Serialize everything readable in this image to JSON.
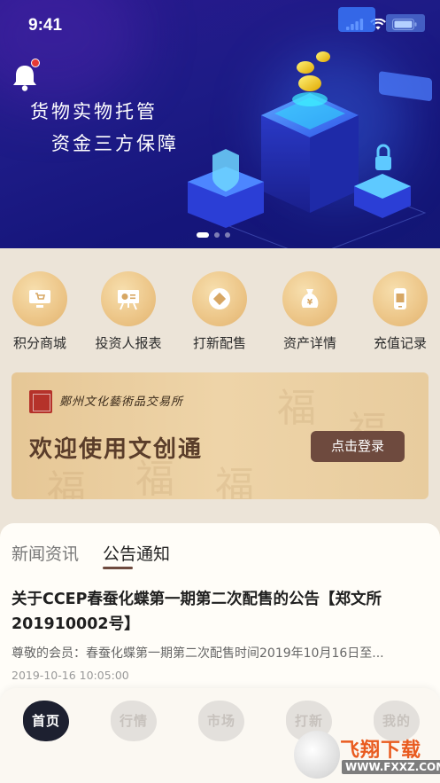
{
  "status_bar": {
    "time": "9:41"
  },
  "hero": {
    "line1": "货物实物托管",
    "line2": "资金三方保障"
  },
  "quick_menu": [
    {
      "label": "积分商城",
      "icon": "computer-cart-icon"
    },
    {
      "label": "投资人报表",
      "icon": "chart-board-icon"
    },
    {
      "label": "打新配售",
      "icon": "coin-icon"
    },
    {
      "label": "资产详情",
      "icon": "money-bag-icon"
    },
    {
      "label": "充值记录",
      "icon": "recharge-phone-icon"
    }
  ],
  "login_card": {
    "organization": "鄭州文化藝術品交易所",
    "welcome": "欢迎使用文创通",
    "login_label": "点击登录"
  },
  "news": {
    "tabs": [
      "新闻资讯",
      "公告通知"
    ],
    "active_tab": "公告通知",
    "article": {
      "title": "关于CCEP春蚕化蝶第一期第二次配售的公告【郑文所201910002号】",
      "summary": "尊敬的会员：春蚕化蝶第一期第二次配售时间2019年10月16日至...",
      "date": "2019-10-16 10:05:00"
    }
  },
  "bottom_nav": [
    "首页",
    "行情",
    "市场",
    "打新",
    "我的"
  ],
  "watermark": {
    "text": "飞翔下载",
    "sub": "WWW.FXXZ.COM"
  },
  "colors": {
    "accent": "#6e4a3e",
    "hero_bg": "#1d1b86",
    "gold": "#edc78a"
  }
}
